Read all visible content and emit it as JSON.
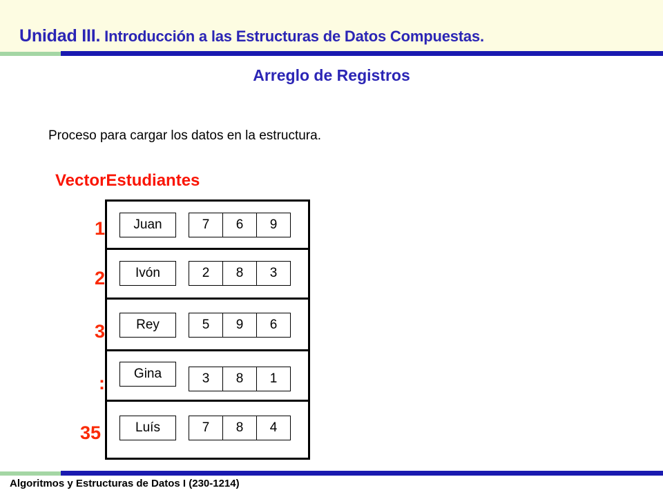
{
  "header": {
    "unit_prefix": "Unidad III.",
    "unit_rest": " Introducción a las Estructuras de Datos Compuestas.",
    "slide_title": "Arreglo de Registros",
    "band_color": "#fdfce2",
    "title_color": "#2b25b5",
    "divider_green": "#a4d6a4",
    "divider_blue": "#1a1ab0"
  },
  "body": {
    "paragraph": "Proceso para cargar los datos en la estructura.",
    "structure_label": "VectorEstudiantes",
    "structure_label_color": "#fa1505"
  },
  "diagram": {
    "index_color": "#fa2a05",
    "rows": [
      {
        "index": "1",
        "name": "Juan",
        "values": [
          "7",
          "6",
          "9"
        ]
      },
      {
        "index": "2",
        "name": "Ivón",
        "values": [
          "2",
          "8",
          "3"
        ]
      },
      {
        "index": "3",
        "name": "Rey",
        "values": [
          "5",
          "9",
          "6"
        ]
      },
      {
        "index": ":",
        "name": "Gina",
        "values": [
          "3",
          "8",
          "1"
        ]
      },
      {
        "index": "35",
        "name": "Luís",
        "values": [
          "7",
          "8",
          "4"
        ]
      }
    ]
  },
  "footer": {
    "course": "Algoritmos y Estructuras de Datos I (230-1214)"
  }
}
